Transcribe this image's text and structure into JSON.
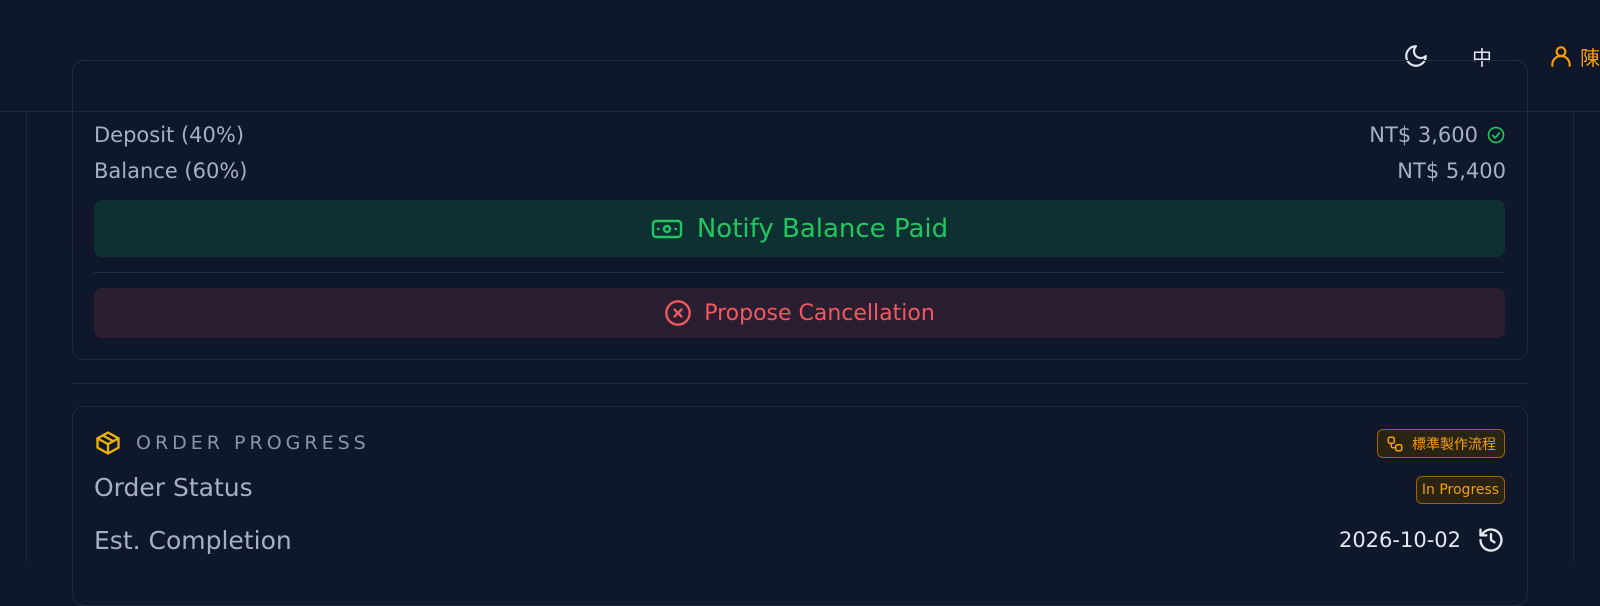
{
  "header": {
    "language_label": "中",
    "user_name": "陳"
  },
  "payment": {
    "deposit_label": "Deposit (40%)",
    "deposit_amount": "NT$ 3,600",
    "balance_label": "Balance (60%)",
    "balance_amount": "NT$ 5,400",
    "notify_button_label": "Notify Balance Paid",
    "cancel_button_label": "Propose Cancellation"
  },
  "progress": {
    "section_title": "ORDER PROGRESS",
    "workflow_badge_label": "標準製作流程",
    "status_label": "Order Status",
    "status_value": "In Progress",
    "completion_label": "Est. Completion",
    "completion_date": "2026-10-02"
  },
  "colors": {
    "background": "#0f172a",
    "accent_green": "#22c55e",
    "accent_red": "#f0595f",
    "accent_amber": "#f59e0b"
  },
  "icons": {
    "theme": "moon-icon",
    "user": "user-icon",
    "deposit_status": "check-circle-icon",
    "notify": "banknote-icon",
    "cancel": "x-circle-icon",
    "section": "package-icon",
    "workflow": "workflow-icon",
    "completion": "history-icon"
  }
}
